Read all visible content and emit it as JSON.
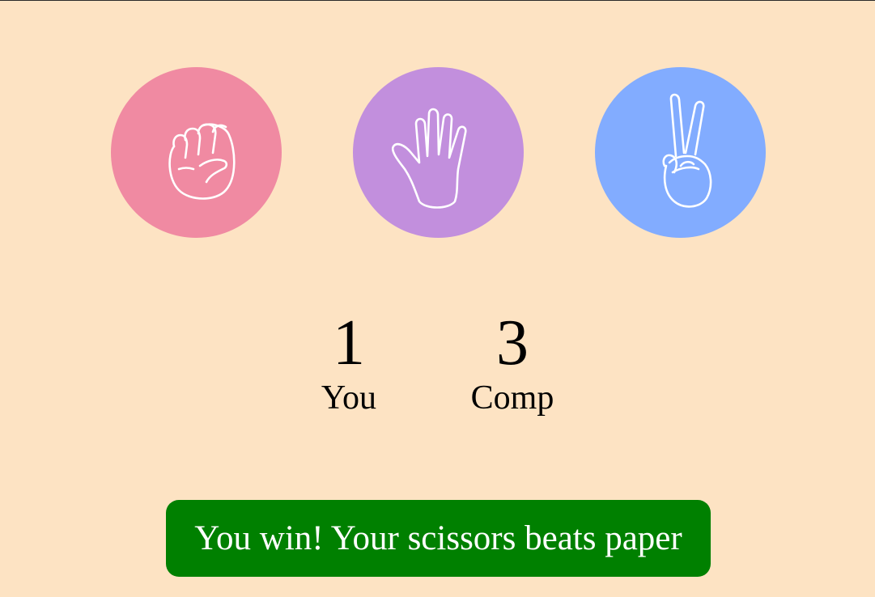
{
  "choices": [
    {
      "id": "rock",
      "icon": "fist-icon",
      "color": "#f08aa2"
    },
    {
      "id": "paper",
      "icon": "open-hand-icon",
      "color": "#c28fdd"
    },
    {
      "id": "scissors",
      "icon": "peace-hand-icon",
      "color": "#82acff"
    }
  ],
  "scoreboard": {
    "you": {
      "score": "1",
      "label": "You"
    },
    "comp": {
      "score": "3",
      "label": "Comp"
    }
  },
  "result": {
    "message": "You win! Your scissors beats paper",
    "color": "#008000"
  },
  "colors": {
    "background": "#fde3c3"
  }
}
